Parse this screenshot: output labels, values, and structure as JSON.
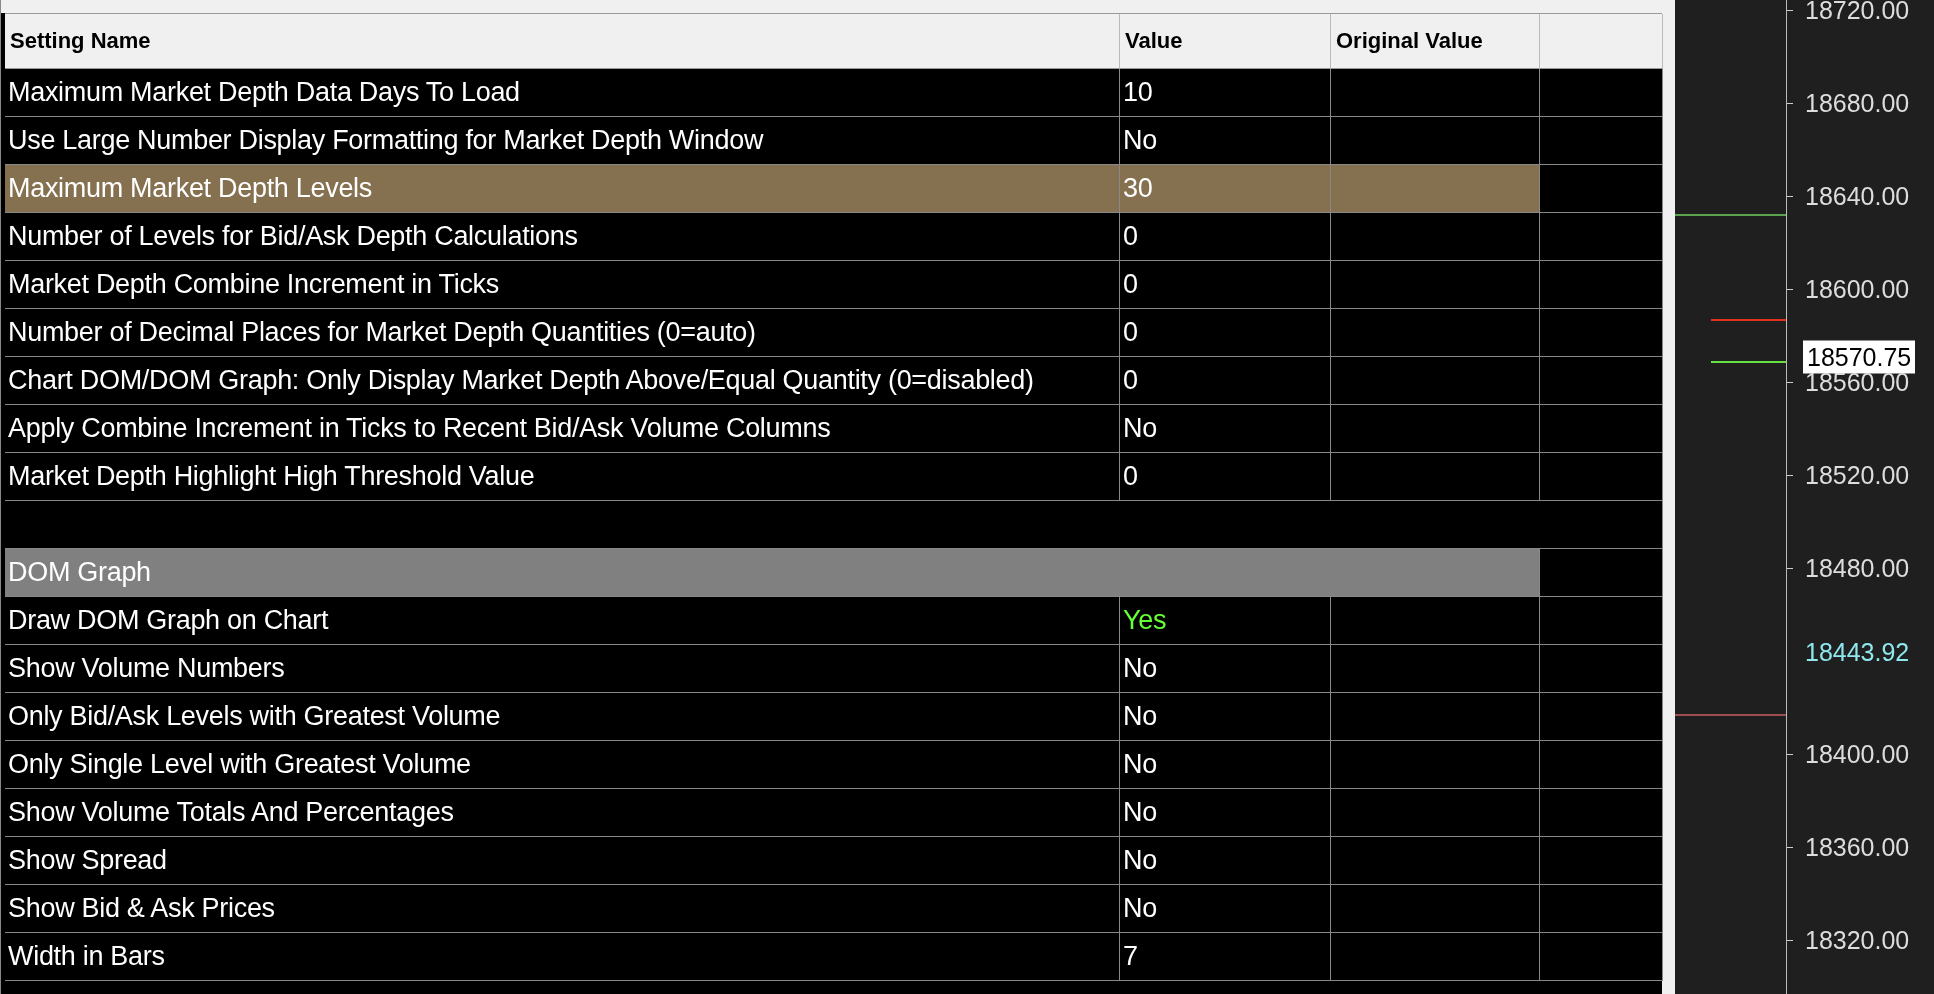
{
  "table": {
    "columns": [
      "Setting Name",
      "Value",
      "Original Value"
    ],
    "rows": [
      {
        "kind": "setting",
        "name": "Maximum Market Depth Data Days To Load",
        "value": "10",
        "color": "#ffffff",
        "selected": false
      },
      {
        "kind": "setting",
        "name": "Use Large Number Display Formatting for Market Depth Window",
        "value": "No",
        "color": "#ffffff",
        "selected": false
      },
      {
        "kind": "setting",
        "name": "Maximum Market Depth Levels",
        "value": "30",
        "color": "#ffffff",
        "selected": true
      },
      {
        "kind": "setting",
        "name": "Number of Levels for Bid/Ask Depth Calculations",
        "value": "0",
        "color": "#ffffff",
        "selected": false
      },
      {
        "kind": "setting",
        "name": "Market Depth Combine Increment in Ticks",
        "value": "0",
        "color": "#ffffff",
        "selected": false
      },
      {
        "kind": "setting",
        "name": "Number of Decimal Places for Market Depth Quantities (0=auto)",
        "value": "0",
        "color": "#ffffff",
        "selected": false
      },
      {
        "kind": "setting",
        "name": "Chart DOM/DOM Graph: Only Display Market Depth Above/Equal Quantity (0=disabled)",
        "value": "0",
        "color": "#ffffff",
        "selected": false
      },
      {
        "kind": "setting",
        "name": "Apply Combine Increment in Ticks to Recent Bid/Ask Volume Columns",
        "value": "No",
        "color": "#ffffff",
        "selected": false
      },
      {
        "kind": "setting",
        "name": "Market Depth Highlight High Threshold Value",
        "value": "0",
        "color": "#ffffff",
        "selected": false
      },
      {
        "kind": "blank"
      },
      {
        "kind": "section",
        "name": "DOM Graph"
      },
      {
        "kind": "setting",
        "name": "Draw DOM Graph on Chart",
        "value": "Yes",
        "color": "#66ff33",
        "selected": false
      },
      {
        "kind": "setting",
        "name": "Show Volume Numbers",
        "value": "No",
        "color": "#ffffff",
        "selected": false
      },
      {
        "kind": "setting",
        "name": "Only Bid/Ask Levels with Greatest Volume",
        "value": "No",
        "color": "#ffffff",
        "selected": false
      },
      {
        "kind": "setting",
        "name": "Only Single Level with Greatest Volume",
        "value": "No",
        "color": "#ffffff",
        "selected": false
      },
      {
        "kind": "setting",
        "name": "Show Volume Totals And Percentages",
        "value": "No",
        "color": "#ffffff",
        "selected": false
      },
      {
        "kind": "setting",
        "name": "Show Spread",
        "value": "No",
        "color": "#ffffff",
        "selected": false
      },
      {
        "kind": "setting",
        "name": "Show Bid & Ask Prices",
        "value": "No",
        "color": "#ffffff",
        "selected": false
      },
      {
        "kind": "setting",
        "name": "Width in Bars",
        "value": "7",
        "color": "#ffffff",
        "selected": false
      }
    ]
  },
  "price_axis": {
    "labels": [
      {
        "kind": "tick",
        "text": "18720.00"
      },
      {
        "kind": "tick",
        "text": "18680.00"
      },
      {
        "kind": "tick",
        "text": "18640.00"
      },
      {
        "kind": "tick",
        "text": "18600.00"
      },
      {
        "kind": "last",
        "text": "18570.75"
      },
      {
        "kind": "tick",
        "text": "18560.00"
      },
      {
        "kind": "tick",
        "text": "18520.00"
      },
      {
        "kind": "tick",
        "text": "18480.00"
      },
      {
        "kind": "marker",
        "text": "18443.92"
      },
      {
        "kind": "tick",
        "text": "18400.00"
      },
      {
        "kind": "tick",
        "text": "18360.00"
      },
      {
        "kind": "tick",
        "text": "18320.00"
      }
    ]
  }
}
